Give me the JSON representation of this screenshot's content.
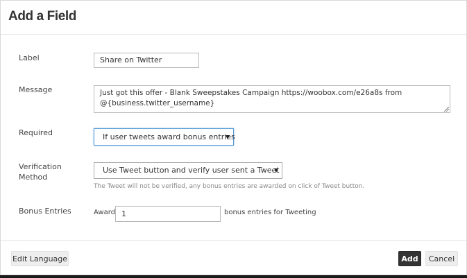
{
  "dialog": {
    "title": "Add a Field"
  },
  "fields": {
    "label": {
      "label": "Label",
      "value": "Share on Twitter"
    },
    "message": {
      "label": "Message",
      "value": "Just got this offer - Blank Sweepstakes Campaign https://woobox.com/e26a8s from @{business.twitter_username}"
    },
    "required": {
      "label": "Required",
      "selected": "If user tweets award bonus entries"
    },
    "verification": {
      "label_line1": "Verification",
      "label_line2": "Method",
      "selected": "Use Tweet button and verify user sent a Tweet",
      "hint": "The Tweet will not be verified, any bonus entries are awarded on click of Tweet button."
    },
    "bonus": {
      "label": "Bonus Entries",
      "prefix": "Award",
      "value": "1",
      "suffix": "bonus entries for Tweeting"
    }
  },
  "footer": {
    "edit_language_label": "Edit Language",
    "add_label": "Add",
    "cancel_label": "Cancel"
  },
  "icons": {
    "select_caret": "caret-down-icon",
    "textarea_resize": "resize-grip-icon"
  }
}
